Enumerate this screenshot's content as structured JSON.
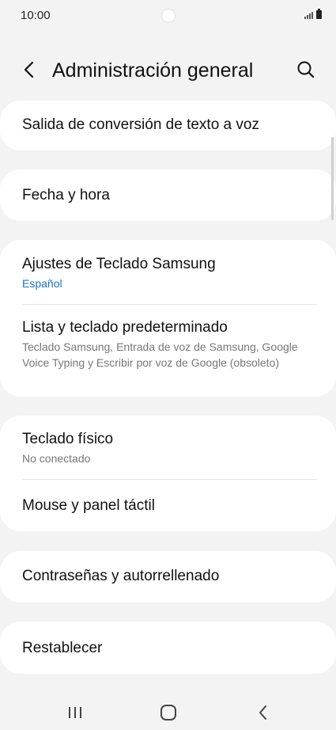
{
  "status": {
    "time": "10:00",
    "signal_icon": "signal-icon",
    "battery_icon": "battery-icon"
  },
  "header": {
    "title": "Administración general",
    "back_icon": "chevron-left-icon",
    "search_icon": "search-icon"
  },
  "items": [
    {
      "title": "Salida de conversión de texto a voz"
    },
    {
      "title": "Fecha y hora"
    },
    {
      "title": "Ajustes de Teclado Samsung",
      "subtitle": "Español"
    },
    {
      "title": "Lista y teclado predeterminado",
      "subtitle": "Teclado Samsung, Entrada de voz de Samsung, Google Voice Typing y Escribir por voz de Google (obsoleto)"
    },
    {
      "title": "Teclado físico",
      "subtitle": "No conectado"
    },
    {
      "title": "Mouse y panel táctil"
    },
    {
      "title": "Contraseñas y autorrellenado"
    },
    {
      "title": "Restablecer"
    }
  ],
  "nav": {
    "recents_icon": "recents-icon",
    "home_icon": "home-icon",
    "back_icon": "back-icon"
  },
  "colors": {
    "background": "#f3f3f3",
    "card": "#ffffff",
    "accent": "#1a73c9"
  }
}
